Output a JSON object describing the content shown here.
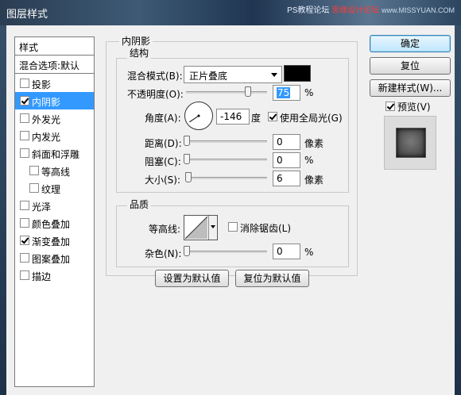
{
  "window": {
    "title": "图层样式"
  },
  "watermark": {
    "prefix": "PS教程论坛",
    "brand": "思缘设计论坛",
    "url": "www.MISSYUAN.COM"
  },
  "sidebar": {
    "header": "样式",
    "blend_options": "混合选项:默认",
    "items": [
      {
        "label": "投影",
        "checked": false
      },
      {
        "label": "内阴影",
        "checked": true,
        "selected": true
      },
      {
        "label": "外发光",
        "checked": false
      },
      {
        "label": "内发光",
        "checked": false
      },
      {
        "label": "斜面和浮雕",
        "checked": false
      },
      {
        "label": "等高线",
        "checked": false
      },
      {
        "label": "纹理",
        "checked": false
      },
      {
        "label": "光泽",
        "checked": false
      },
      {
        "label": "颜色叠加",
        "checked": false
      },
      {
        "label": "渐变叠加",
        "checked": true
      },
      {
        "label": "图案叠加",
        "checked": false
      },
      {
        "label": "描边",
        "checked": false
      }
    ]
  },
  "inner_shadow": {
    "group_title": "内阴影",
    "structure": {
      "title": "结构",
      "blend_mode_label": "混合模式(B):",
      "blend_mode_value": "正片叠底",
      "color": "#000000",
      "opacity_label": "不透明度(O):",
      "opacity_value": "75",
      "opacity_unit": "%",
      "opacity_level": 0.75,
      "angle_label": "角度(A):",
      "angle_value": "-146",
      "angle_unit": "度",
      "global_light_label": "使用全局光(G)",
      "global_light_checked": true,
      "distance_label": "距离(D):",
      "distance_value": "0",
      "distance_unit": "像素",
      "distance_level": 0,
      "choke_label": "阻塞(C):",
      "choke_value": "0",
      "choke_unit": "%",
      "choke_level": 0,
      "size_label": "大小(S):",
      "size_value": "6",
      "size_unit": "像素",
      "size_level": 0.024
    },
    "quality": {
      "title": "品质",
      "contour_label": "等高线:",
      "antialias_label": "消除锯齿(L)",
      "antialias_checked": false,
      "noise_label": "杂色(N):",
      "noise_value": "0",
      "noise_unit": "%",
      "noise_level": 0
    },
    "set_default": "设置为默认值",
    "reset_default": "复位为默认值"
  },
  "buttons": {
    "ok": "确定",
    "reset": "复位",
    "new_style": "新建样式(W)..."
  },
  "preview": {
    "label": "预览(V)",
    "checked": true
  }
}
